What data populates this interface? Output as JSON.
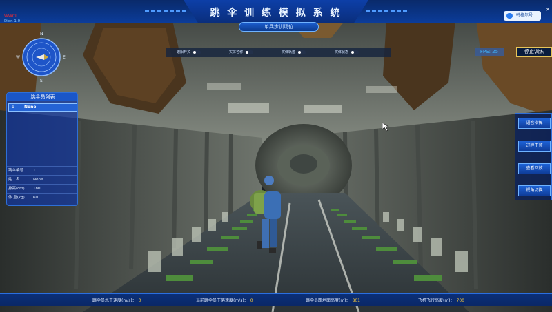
{
  "header": {
    "title": "跳 伞 训 练 模 拟 系 统",
    "subtitle": "单兵步训场位",
    "warning_line1": "WWCL",
    "warning_line2": "Dion 1.0"
  },
  "user": {
    "label": "韩格尔号"
  },
  "toggles": [
    {
      "label": "遮阳开关"
    },
    {
      "label": "实体名称"
    },
    {
      "label": "实体轨迹"
    },
    {
      "label": "实体状态"
    }
  ],
  "fps": "FPS: 25",
  "stop_button": "停止训练",
  "compass": {
    "n": "N",
    "s": "S",
    "e": "E",
    "w": "W"
  },
  "roster": {
    "title": "跳伞员列表",
    "selected": {
      "index": "1",
      "name": "None"
    },
    "info": [
      {
        "key": "跳伞编号：",
        "value": "1"
      },
      {
        "key": "姓　名",
        "value": "None"
      },
      {
        "key": "身高(cm)",
        "value": "180"
      },
      {
        "key": "体 重(kg)：",
        "value": "60"
      }
    ]
  },
  "right_buttons": [
    "语音指挥",
    "过程干预",
    "查看回放",
    "视角切换"
  ],
  "status": [
    {
      "label": "跳伞员水平速度(m/s)：",
      "value": "0"
    },
    {
      "label": "当前跳伞员下落速度(m/s)：",
      "value": "0"
    },
    {
      "label": "跳伞员距地面高度(m)：",
      "value": "801"
    },
    {
      "label": "飞机飞行高度(m)：",
      "value": "700"
    }
  ]
}
